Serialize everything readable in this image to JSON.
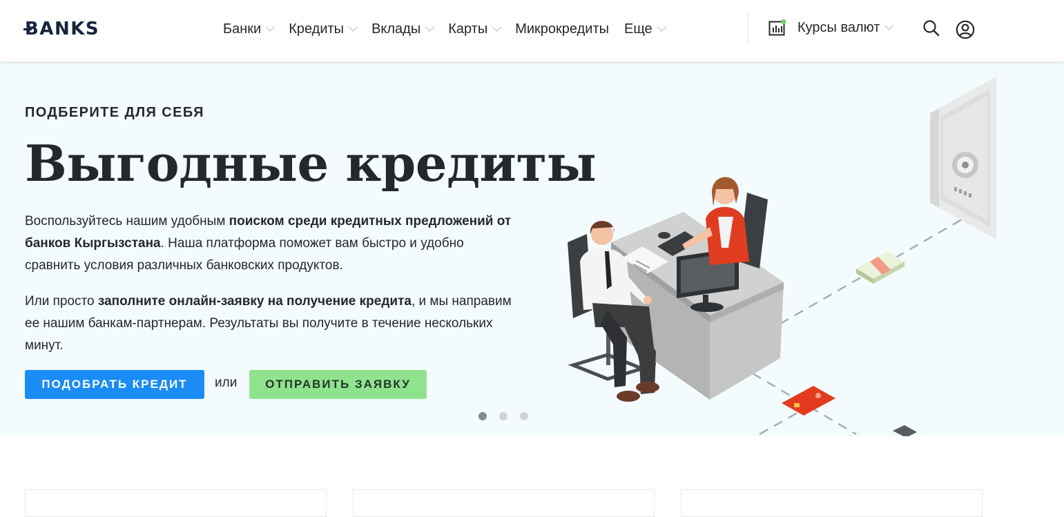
{
  "header": {
    "logo": "BANKS",
    "nav": [
      {
        "label": "Банки",
        "dropdown": true
      },
      {
        "label": "Кредиты",
        "dropdown": true
      },
      {
        "label": "Вклады",
        "dropdown": true
      },
      {
        "label": "Карты",
        "dropdown": true
      },
      {
        "label": "Микрокредиты",
        "dropdown": false
      },
      {
        "label": "Еще",
        "dropdown": true
      }
    ],
    "rates_label": "Курсы валют",
    "icons": {
      "rates": "chart-icon",
      "search": "search-icon",
      "user": "user-icon"
    }
  },
  "hero": {
    "kicker": "ПОДБЕРИТЕ ДЛЯ СЕБЯ",
    "title": "Выгодные кредиты",
    "para1": {
      "t1": "Воспользуйтесь нашим удобным ",
      "b1": "поиском среди кредитных предложений от банков Кыргызстана",
      "t2": ". Наша платформа поможет вам быстро и удобно сравнить условия различных банковских продуктов."
    },
    "para2": {
      "t1": "Или просто ",
      "b1": "заполните онлайн-заявку на получение кредита",
      "t2": ", и мы направим ее нашим банкам-партнерам. Результаты вы получите в течение нескольких минут."
    },
    "btn_primary": "ПОДОБРАТЬ КРЕДИТ",
    "or": "или",
    "btn_secondary": "ОТПРАВИТЬ ЗАЯВКУ",
    "slides": 3,
    "active_slide": 1
  },
  "colors": {
    "accent_blue": "#1a8cf5",
    "accent_green": "#8fe38d",
    "hero_bg": "#f3fbfd",
    "text": "#24282b",
    "logo": "#14253c",
    "status_dot": "#6fd26a"
  }
}
